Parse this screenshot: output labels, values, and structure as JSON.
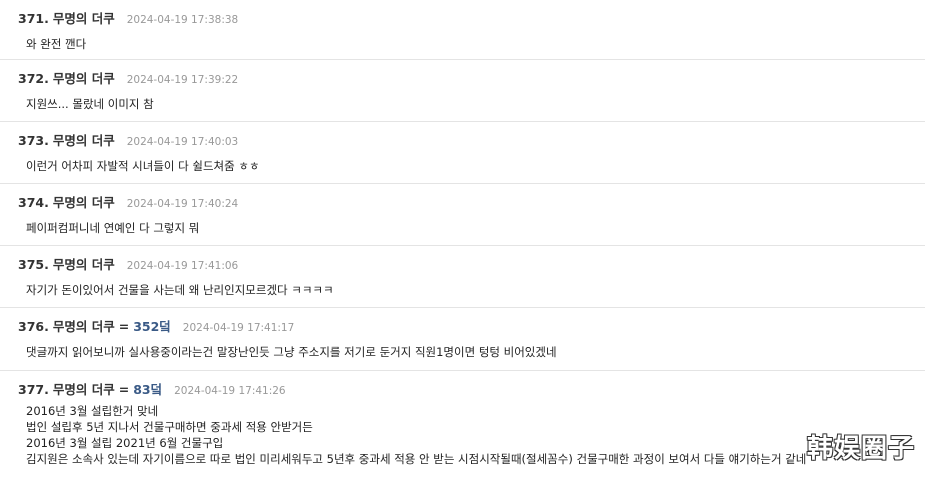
{
  "posts": [
    {
      "num": "371.",
      "author": "무명의 더쿠",
      "time": "2024-04-19 17:38:38",
      "lines": [
        "와 완전 깬다"
      ]
    },
    {
      "num": "372.",
      "author": "무명의 더쿠",
      "time": "2024-04-19 17:39:22",
      "lines": [
        "지원쓰... 몰랐네 이미지 참"
      ]
    },
    {
      "num": "373.",
      "author": "무명의 더쿠",
      "time": "2024-04-19 17:40:03",
      "lines": [
        "이런거 어차피 자발적 시녀들이 다 쉴드쳐줌 ㅎㅎ"
      ]
    },
    {
      "num": "374.",
      "author": "무명의 더쿠",
      "time": "2024-04-19 17:40:24",
      "lines": [
        "페이퍼컴퍼니네 연예인 다 그렇지 뭐"
      ]
    },
    {
      "num": "375.",
      "author": "무명의 더쿠",
      "time": "2024-04-19 17:41:06",
      "lines": [
        "자기가 돈이있어서 건물을 사는데 왜 난리인지모르겠다 ㅋㅋㅋㅋ"
      ]
    },
    {
      "num": "376.",
      "author": "무명의 더쿠",
      "eq": "=",
      "ref": "352덬",
      "time": "2024-04-19 17:41:17",
      "lines": [
        "댓글까지 읽어보니까 실사용중이라는건 말장난인듯 그냥 주소지를 저기로 둔거지 직원1명이면 텅텅 비어있겠네"
      ]
    },
    {
      "num": "377.",
      "author": "무명의 더쿠",
      "eq": "=",
      "ref": "83덬",
      "time": "2024-04-19 17:41:26",
      "lines": [
        "2016년 3월 설립한거 맞네",
        "법인 설립후 5년 지나서 건물구매하면 중과세 적용 안받거든",
        "2016년 3월 설립 2021년 6월 건물구입",
        "김지원은 소속사 있는데 자기이름으로 따로 법인 미리세워두고 5년후 중과세 적용 안 받는 시점시작될때(절세꼼수) 건물구매한 과정이 보여서 다들 얘기하는거 같네"
      ]
    }
  ],
  "watermark": "韩娱圈子"
}
